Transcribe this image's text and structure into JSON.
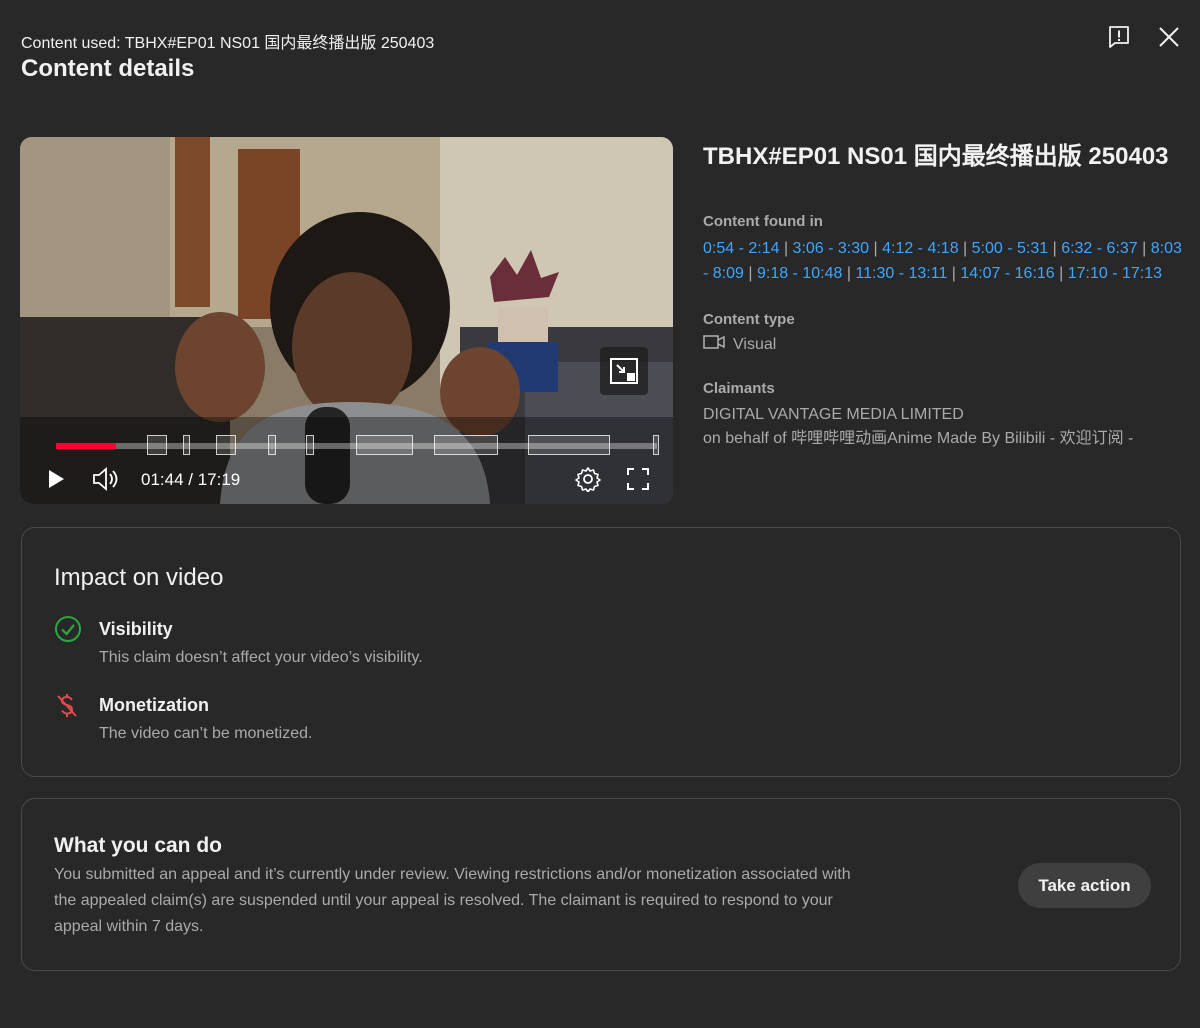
{
  "header": {
    "content_used": "Content used: TBHX#EP01 NS01 国内最终播出版 250403",
    "title": "Content details"
  },
  "icons": {
    "report": "report-flag-icon",
    "close": "close-icon",
    "play": "play-icon",
    "volume": "volume-icon",
    "settings": "gear-icon",
    "fullscreen": "fullscreen-icon",
    "miniplayer": "miniplayer-icon",
    "content_type": "video-camera-icon",
    "visibility": "check-circle-icon",
    "monetization": "demonetized-dollar-icon"
  },
  "player": {
    "time": "01:44 / 17:19",
    "progress_fraction": 0.1
  },
  "info": {
    "title": "TBHX#EP01 NS01 国内最终播出版 250403",
    "content_found_label": "Content found in",
    "segments": [
      "0:54 - 2:14",
      "3:06 - 3:30",
      "4:12 - 4:18",
      "5:00 - 5:31",
      "6:32 - 6:37",
      "8:03 - 8:09",
      "9:18 - 10:48",
      "11:30 - 13:11",
      "14:07 - 16:16",
      "17:10 - 17:13"
    ],
    "content_type_label": "Content type",
    "content_type": "Visual",
    "claimants_label": "Claimants",
    "claimant_name": "DIGITAL VANTAGE MEDIA LIMITED",
    "claimant_behalf": "on behalf of 哔哩哔哩动画Anime Made By Bilibili - 欢迎订阅 -"
  },
  "impact": {
    "title": "Impact on video",
    "visibility_label": "Visibility",
    "visibility_text": "This claim doesn’t affect your video’s visibility.",
    "monetization_label": "Monetization",
    "monetization_text": "The video can’t be monetized."
  },
  "whatdo": {
    "title": "What you can do",
    "description": "You submitted an appeal and it’s currently under review. Viewing restrictions and/or monetization associated with the appealed claim(s) are suspended until your appeal is resolved. The claimant is required to respond to your appeal within 7 days.",
    "button": "Take action"
  },
  "colors": {
    "background": "#282828",
    "link": "#3ea6ff",
    "progress": "#ff0033",
    "success": "#2ba640",
    "danger": "#e5484d"
  }
}
